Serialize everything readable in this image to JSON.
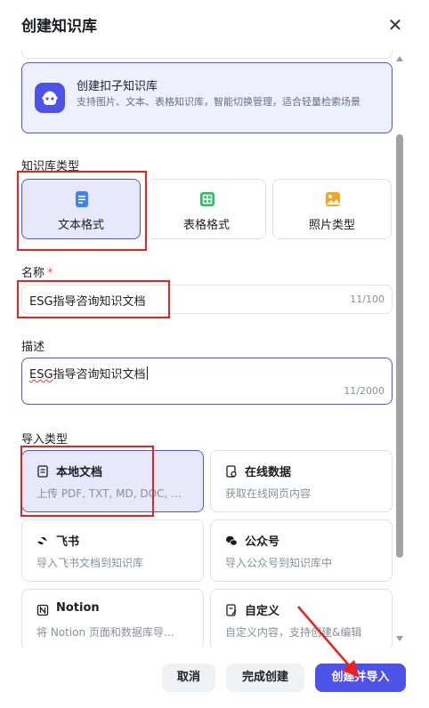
{
  "dialog": {
    "title": "创建知识库",
    "close_glyph": "✕"
  },
  "product": {
    "title": "创建扣子知识库",
    "desc": "支持图片、文本、表格知识库，智能切换管理，适合轻量检索场景"
  },
  "kb_type": {
    "label": "知识库类型",
    "options": [
      {
        "label": "文本格式",
        "icon": "text-doc-icon",
        "selected": true
      },
      {
        "label": "表格格式",
        "icon": "table-icon",
        "selected": false
      },
      {
        "label": "照片类型",
        "icon": "image-icon",
        "selected": false
      }
    ]
  },
  "name_field": {
    "label": "名称",
    "required_mark": "*",
    "value": "ESG指导咨询知识文档",
    "count": "11/100"
  },
  "desc_field": {
    "label": "描述",
    "value_prefix": "ESG",
    "value_rest": "指导咨询知识文档",
    "count": "11/2000"
  },
  "import_type": {
    "label": "导入类型",
    "options": [
      {
        "title": "本地文档",
        "desc": "上传 PDF, TXT, MD, DOC, …",
        "icon": "document-icon",
        "selected": true
      },
      {
        "title": "在线数据",
        "desc": "获取在线网页内容",
        "icon": "web-page-icon",
        "selected": false
      },
      {
        "title": "飞书",
        "desc": "导入飞书文档到知识库",
        "icon": "feishu-icon",
        "selected": false
      },
      {
        "title": "公众号",
        "desc": "导入公众号到知识库中",
        "icon": "wechat-icon",
        "selected": false
      },
      {
        "title": "Notion",
        "desc": "将 Notion 页面和数据库导…",
        "icon": "notion-icon",
        "selected": false
      },
      {
        "title": "自定义",
        "desc": "自定义内容，支持创建&编辑",
        "icon": "custom-edit-icon",
        "selected": false
      }
    ]
  },
  "footer": {
    "cancel": "取消",
    "finish": "完成创建",
    "create_import": "创建并导入"
  },
  "colors": {
    "accent": "#4d53e8",
    "selected_bg": "#e7e8fb",
    "annotation_red": "#e8231d"
  }
}
